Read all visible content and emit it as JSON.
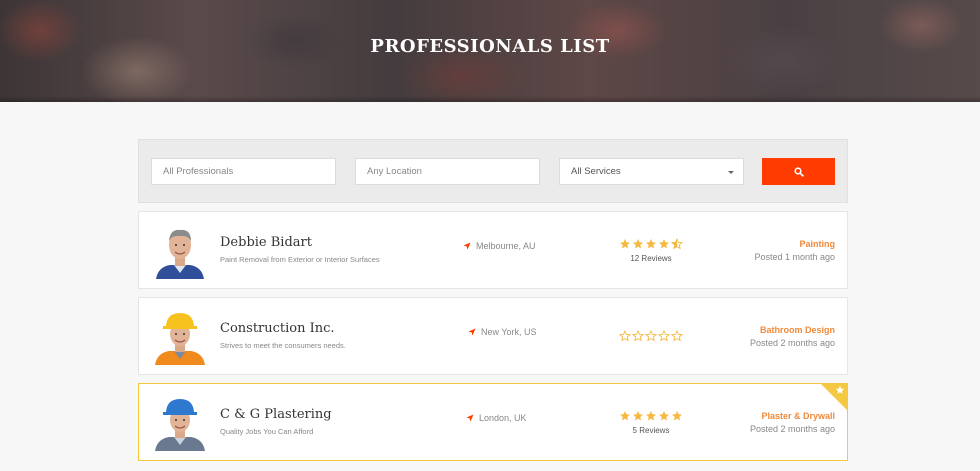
{
  "header": {
    "title": "PROFESSIONALS LIST"
  },
  "search": {
    "professional_placeholder": "All Professionals",
    "location_placeholder": "Any Location",
    "service_selected": "All Services",
    "search_icon": "search-icon"
  },
  "colors": {
    "accent": "#ff3b00",
    "star": "#f5b942",
    "category": "#f08a3c",
    "featured_border": "#f5c842"
  },
  "listings": [
    {
      "name": "Debbie Bidart",
      "description": "Paint Removal from Exterior or Interior Surfaces",
      "location": "Melbourne, AU",
      "rating": 4.5,
      "reviews": "12 Reviews",
      "category": "Painting",
      "posted": "Posted 1 month ago",
      "featured": false
    },
    {
      "name": "Construction Inc.",
      "description": "Strives to meet the consumers needs.",
      "location": "New York, US",
      "rating": 0,
      "reviews": "",
      "category": "Bathroom Design",
      "posted": "Posted 2 months ago",
      "featured": false
    },
    {
      "name": "C & G Plastering",
      "description": "Quality Jobs You Can Afford",
      "location": "London, UK",
      "rating": 5,
      "reviews": "5 Reviews",
      "category": "Plaster & Drywall",
      "posted": "Posted 2 months ago",
      "featured": true
    }
  ]
}
